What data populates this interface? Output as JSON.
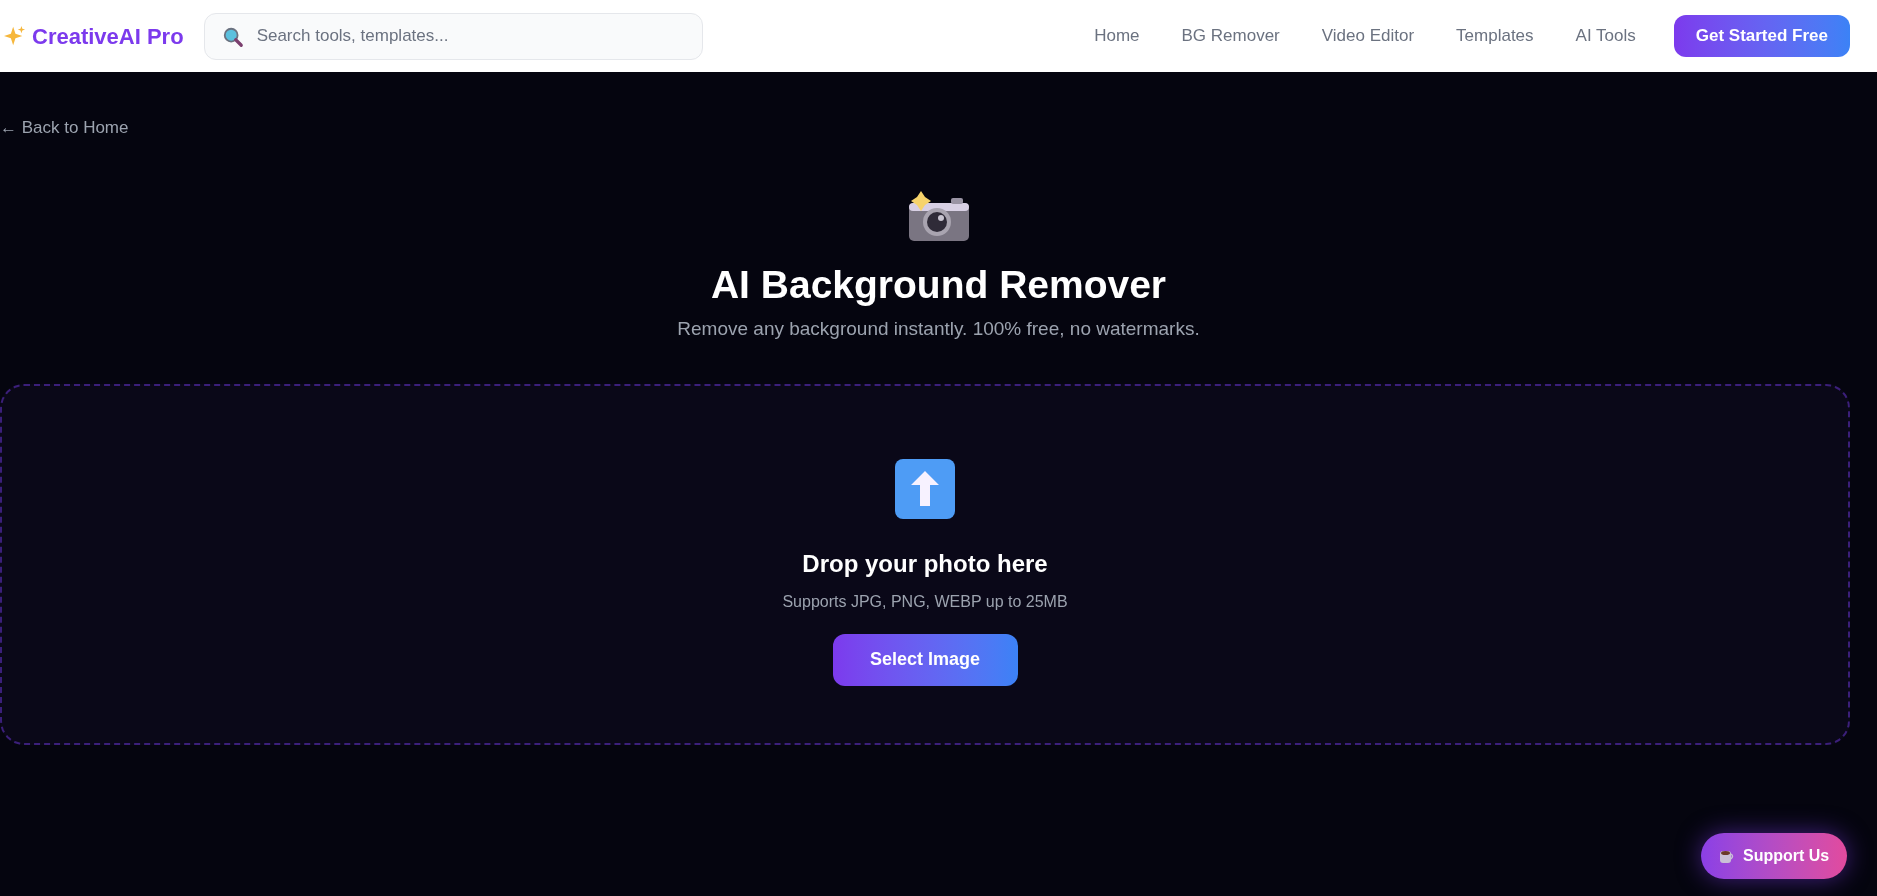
{
  "header": {
    "logo": "CreativeAI Pro",
    "search": {
      "placeholder": "Search tools, templates..."
    },
    "nav": [
      "Home",
      "BG Remover",
      "Video Editor",
      "Templates",
      "AI Tools"
    ],
    "cta": "Get Started Free"
  },
  "back_link": "← Back to Home",
  "hero": {
    "title": "AI Background Remover",
    "subtitle": "Remove any background instantly. 100% free, no watermarks."
  },
  "dropzone": {
    "title": "Drop your photo here",
    "hint": "Supports JPG, PNG, WEBP up to 25MB",
    "button": "Select Image"
  },
  "support_button": "Support Us"
}
